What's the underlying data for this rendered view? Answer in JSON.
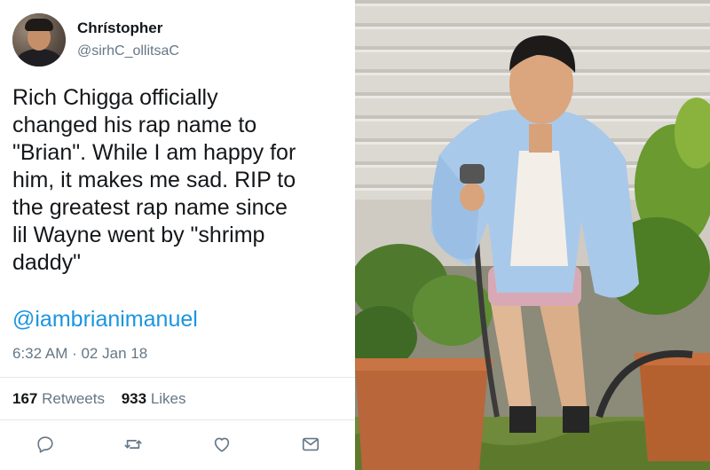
{
  "tweet": {
    "display_name": "Chrístopher",
    "handle": "@sirhC_ollitsaC",
    "text": "Rich Chigga officially\nchanged his rap name to\n\"Brian\". While I am happy for\nhim, it makes me sad. RIP to\nthe greatest rap name since\nlil Wayne went by \"shrimp\ndaddy\"",
    "mention": "@iambrianimanuel",
    "timestamp": "6:32 AM · 02 Jan 18",
    "retweets_count": "167",
    "retweets_label": "Retweets",
    "likes_count": "933",
    "likes_label": "Likes"
  },
  "actions": {
    "icons": [
      "reply-icon",
      "retweet-icon",
      "like-icon",
      "direct-message-icon"
    ]
  },
  "colors": {
    "text": "#14171a",
    "secondary": "#657786",
    "link": "#1b95e0",
    "divider": "#e1e8ed"
  }
}
